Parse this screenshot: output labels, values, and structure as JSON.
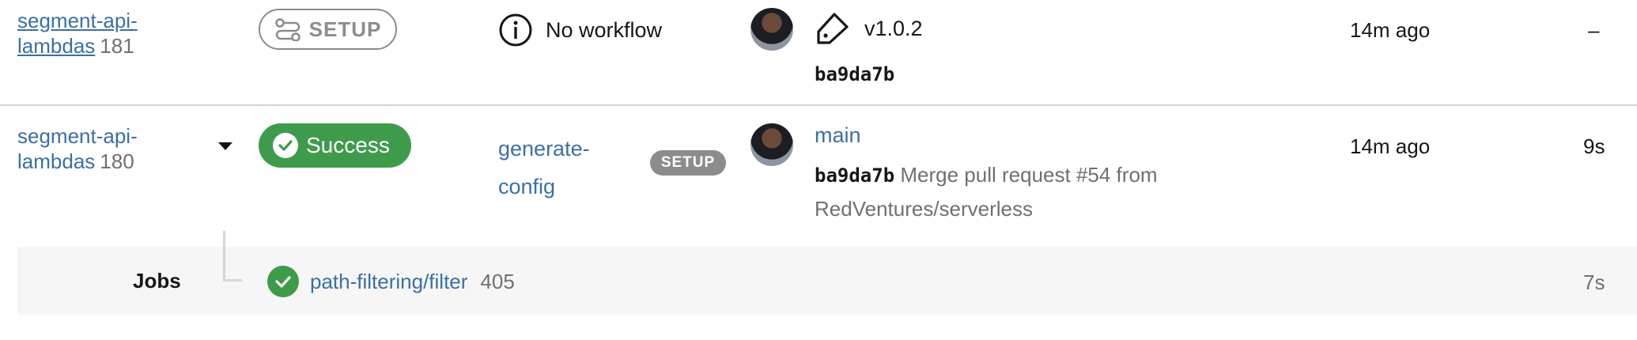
{
  "rows": [
    {
      "project": "segment-api-lambdas",
      "project_line1": "segment-api-",
      "project_line2": "lambdas",
      "build_number": "181",
      "status": "SETUP",
      "workflow": "No workflow",
      "tag": "v1.0.2",
      "commit_sha": "ba9da7b",
      "time_ago": "14m ago",
      "duration": "–"
    },
    {
      "project": "segment-api-lambdas",
      "project_line1": "segment-api-",
      "project_line2": "lambdas",
      "build_number": "180",
      "status": "Success",
      "workflow_line1": "generate-",
      "workflow_line2": "config",
      "workflow_badge": "SETUP",
      "branch": "main",
      "commit_sha": "ba9da7b",
      "commit_msg_line1": "Merge pull request #54 from",
      "commit_msg_line2": "RedVentures/serverless",
      "time_ago": "14m ago",
      "duration": "9s"
    }
  ],
  "jobs": {
    "label": "Jobs",
    "items": [
      {
        "name": "path-filtering/filter",
        "number": "405",
        "duration": "7s",
        "status": "success"
      }
    ]
  },
  "icons": {
    "setup": "settings-flow-icon",
    "info": "info-icon",
    "tag": "tag-icon",
    "expand": "caret-down-icon",
    "success": "check-icon"
  },
  "colors": {
    "link": "#3b6fa6",
    "success": "#3f9b4c",
    "setup_gray": "#8c8c8c"
  }
}
